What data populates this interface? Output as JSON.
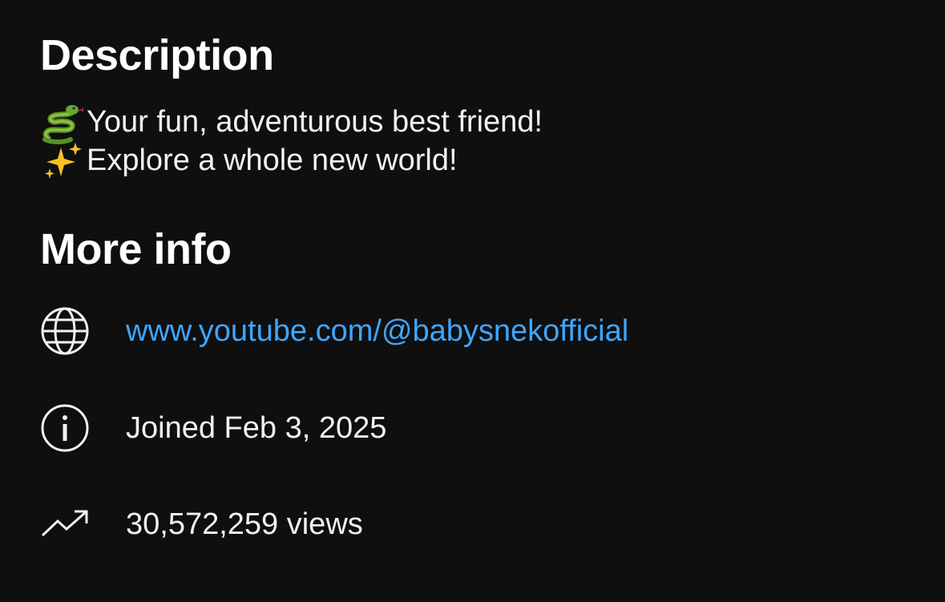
{
  "description": {
    "title": "Description",
    "lines": [
      {
        "emoji": "snake-emoji",
        "text": "Your fun, adventurous best friend!"
      },
      {
        "emoji": "sparkles-emoji",
        "text": "Explore a whole new world!"
      }
    ]
  },
  "more_info": {
    "title": "More info",
    "link": {
      "icon": "globe-icon",
      "text": "www.youtube.com/@babysnekofficial",
      "color": "#3ea6ff"
    },
    "joined": {
      "icon": "info-icon",
      "text": "Joined Feb 3, 2025"
    },
    "views": {
      "icon": "trending-up-icon",
      "text": "30,572,259 views"
    }
  },
  "colors": {
    "background": "#0f0f0f",
    "text": "#f1f1f1",
    "link": "#3ea6ff"
  }
}
